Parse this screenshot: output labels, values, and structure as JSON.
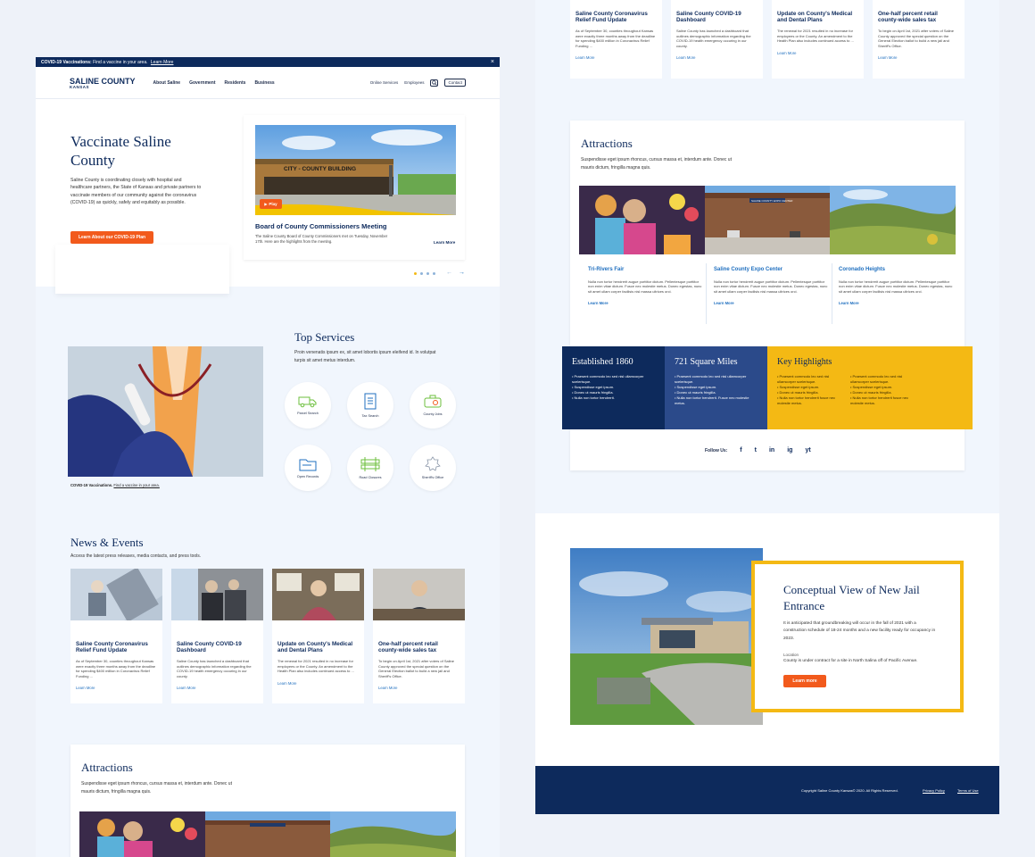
{
  "alert": {
    "text": "COVID-19 Vaccinations: Find a vaccine in your area.",
    "prefix": "COVID-19 Vaccinations:",
    "msg": "Find a vaccine in your area.",
    "link": "Learn More",
    "close": "×"
  },
  "header": {
    "logo_title": "SALINE COUNTY",
    "logo_sub": "KANSAS",
    "nav": [
      "About Saline",
      "Government",
      "Residents",
      "Business"
    ],
    "utility": [
      "Online Services",
      "Employees"
    ],
    "contact": "Contact"
  },
  "hero": {
    "title": "Vaccinate Saline County",
    "body": "Saline County is coordinating closely with hospital and healthcare partners, the State of Kansas and private partners to vaccinate members of our community against the coronavirus (COVID-19) as quickly, safely and equitably as possible.",
    "cta": "Learn About our COVID-19 Plan",
    "feature_building_sign": "CITY - COUNTY BUILDING",
    "feature_play": "Play",
    "feature_title": "Board of County Commissioners Meeting",
    "feature_body": "The Saline County Board of County Commissioners met on Tuesday, November 17th. Here are the highlights from the meeting.",
    "feature_link": "Learn More"
  },
  "services": {
    "title": "Top Services",
    "body": "Proin venenatis ipsum ex, sit amet lobortis ipsum eleifend id. In volutpat turpis sit amet metus interdum.",
    "items": [
      {
        "label": "Parcel Search",
        "icon": "truck-icon"
      },
      {
        "label": "Tax Search",
        "icon": "document-icon"
      },
      {
        "label": "County Jobs",
        "icon": "toolbox-icon"
      },
      {
        "label": "Open Records",
        "icon": "folder-icon"
      },
      {
        "label": "Road Closures",
        "icon": "barrier-icon"
      },
      {
        "label": "Sheriff's Office",
        "icon": "badge-icon"
      }
    ],
    "caption_bold": "COVID-19 Vaccinations.",
    "caption_link": "Find a vaccine in your area."
  },
  "news": {
    "title": "News & Events",
    "sub": "Access the latest press releases, media contacts, and press tools.",
    "items": [
      {
        "title": "Saline County Coronavirus Relief Fund Update",
        "body": "As of September 30, counties throughout Kansas were exactly three months away from the deadline for spending $400 million in Coronavirus Relief Funding ...",
        "link": "Learn More"
      },
      {
        "title": "Saline County  COVID-19 Dashboard",
        "body": "Saline County has launched a dashboard that outlines demographic information regarding the COVID-19 health emergency occuring in our county.",
        "link": "Learn More"
      },
      {
        "title": "Update on County's Medical and Dental Plans",
        "body": "The renewal for 2021 resulted in no increase for employees or the County. An amendment to the Health Plan also includes continued access to ...",
        "link": "Learn More"
      },
      {
        "title": "One-half percent retail county-wide sales tax",
        "body": "To begin on April 1st, 2021 after voters of Saline County approved the special question on the General Election ballot to build a new jail and Sheriff's Office.",
        "link": "Learn More"
      }
    ]
  },
  "attractions": {
    "title": "Attractions",
    "body": "Suspendisse eget ipsum rhoncus, cursus massa et, interdum ante. Donec ut mauris dictum, fringilla magna quis.",
    "sign": "SALINE COUNTY EXPO CENTER",
    "items": [
      {
        "title": "Tri-Rivers Fair",
        "body": "Nulla non tortor hendrerit augue porttitor dictum. Pellentesque porttitor non enim vitae dictum. Fusce nec molestie metus. Donec egestas, nunc sit amet ullam corper facilisis nisl massa ultrices orci.",
        "link": "Learn More"
      },
      {
        "title": "Saline County Expo Center",
        "body": "Nulla non tortor hendrerit augue porttitor dictum. Pellentesque porttitor non enim vitae dictum. Fusce nec molestie metus. Donec egestas, nunc sit amet ullam corper facilisis nisl massa ultrices orci.",
        "link": "Learn More"
      },
      {
        "title": "Coronado Heights",
        "body": "Nulla non tortor hendrerit augue porttitor dictum. Pellentesque porttitor non enim vitae dictum. Fusce nec molestie metus. Donec egestas, nunc sit amet ullam corper facilisis nisl massa ultrices orci.",
        "link": "Learn More"
      }
    ]
  },
  "stats": {
    "established": {
      "title": "Established 1860",
      "items": [
        "Praesent commodo leo sed nisl ullamcorper scelerisque.",
        "Suspendisse eget ipsum.",
        "Donec ut mauris fringilla.",
        "Nulla non tortor hendrerit."
      ]
    },
    "area": {
      "title": "721 Square Miles",
      "items": [
        "Praesent commodo leo sed nisl ullamcorper scelerisque.",
        "Suspendisse eget ipsum.",
        "Donec ut mauris fringilla.",
        "Nulla non tortor hendrerit. Fusce nec molestie metus."
      ]
    },
    "highlights": {
      "title": "Key Highlights",
      "col1": [
        "Praesent commodo leo sed nisl ullamcorper scelerisque.",
        "Suspendisse eget ipsum.",
        "Donec ut mauris fringilla.",
        "Nulla non tortor hendrerit fusce nec molestie metus."
      ],
      "col2": [
        "Praesent commodo leo sed nisl ullamcorper scelerisque.",
        "Suspendisse eget ipsum.",
        "Donec ut mauris fringilla.",
        "Nulla non tortor hendrerit fusce nec molestie metus."
      ]
    }
  },
  "follow": {
    "label": "Follow Us:",
    "icons": [
      "f",
      "t",
      "in",
      "ig",
      "yt"
    ]
  },
  "jail": {
    "title": "Conceptual View of New Jail Entrance",
    "body": "It is anticipated that groundbreaking will occur in the fall of 2021 with a construction schedule of 18-24 months and a new facility ready for occupancy in 2023.",
    "location_label": "Location",
    "location": "County is under contract for a site in North Salina off of Pacific Avenue.",
    "cta": "Learn more"
  },
  "footer": {
    "copyright": "Copyright Saline County Kansas© 2020. All Rights Reserved.",
    "privacy": "Privacy Policy",
    "terms": "Terms of Use"
  },
  "colors": {
    "navy": "#0d2a5c",
    "orange": "#f25a1c",
    "gold": "#f4b914",
    "blue_link": "#1f6fbf"
  }
}
